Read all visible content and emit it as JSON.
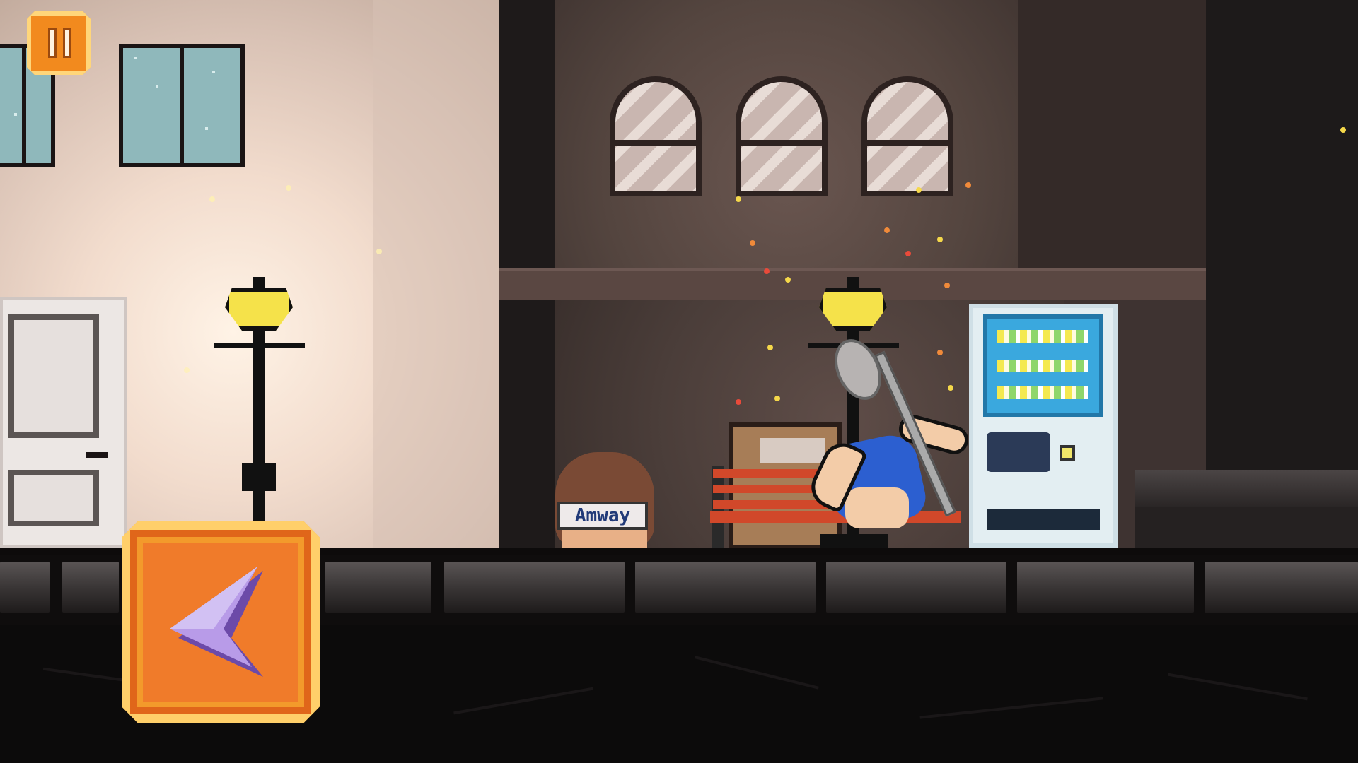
{
  "game": {
    "npc_headband_text": "Amway",
    "colors": {
      "button_orange": "#f39a2b",
      "button_border": "#ffcf6a",
      "arrow_purple": "#b89be8",
      "lamp_yellow": "#f5e24a",
      "hero_hair": "#2c5fd0"
    }
  },
  "hud": {
    "pause_icon": "pause-icon",
    "left_icon": "left-arrow-icon"
  }
}
